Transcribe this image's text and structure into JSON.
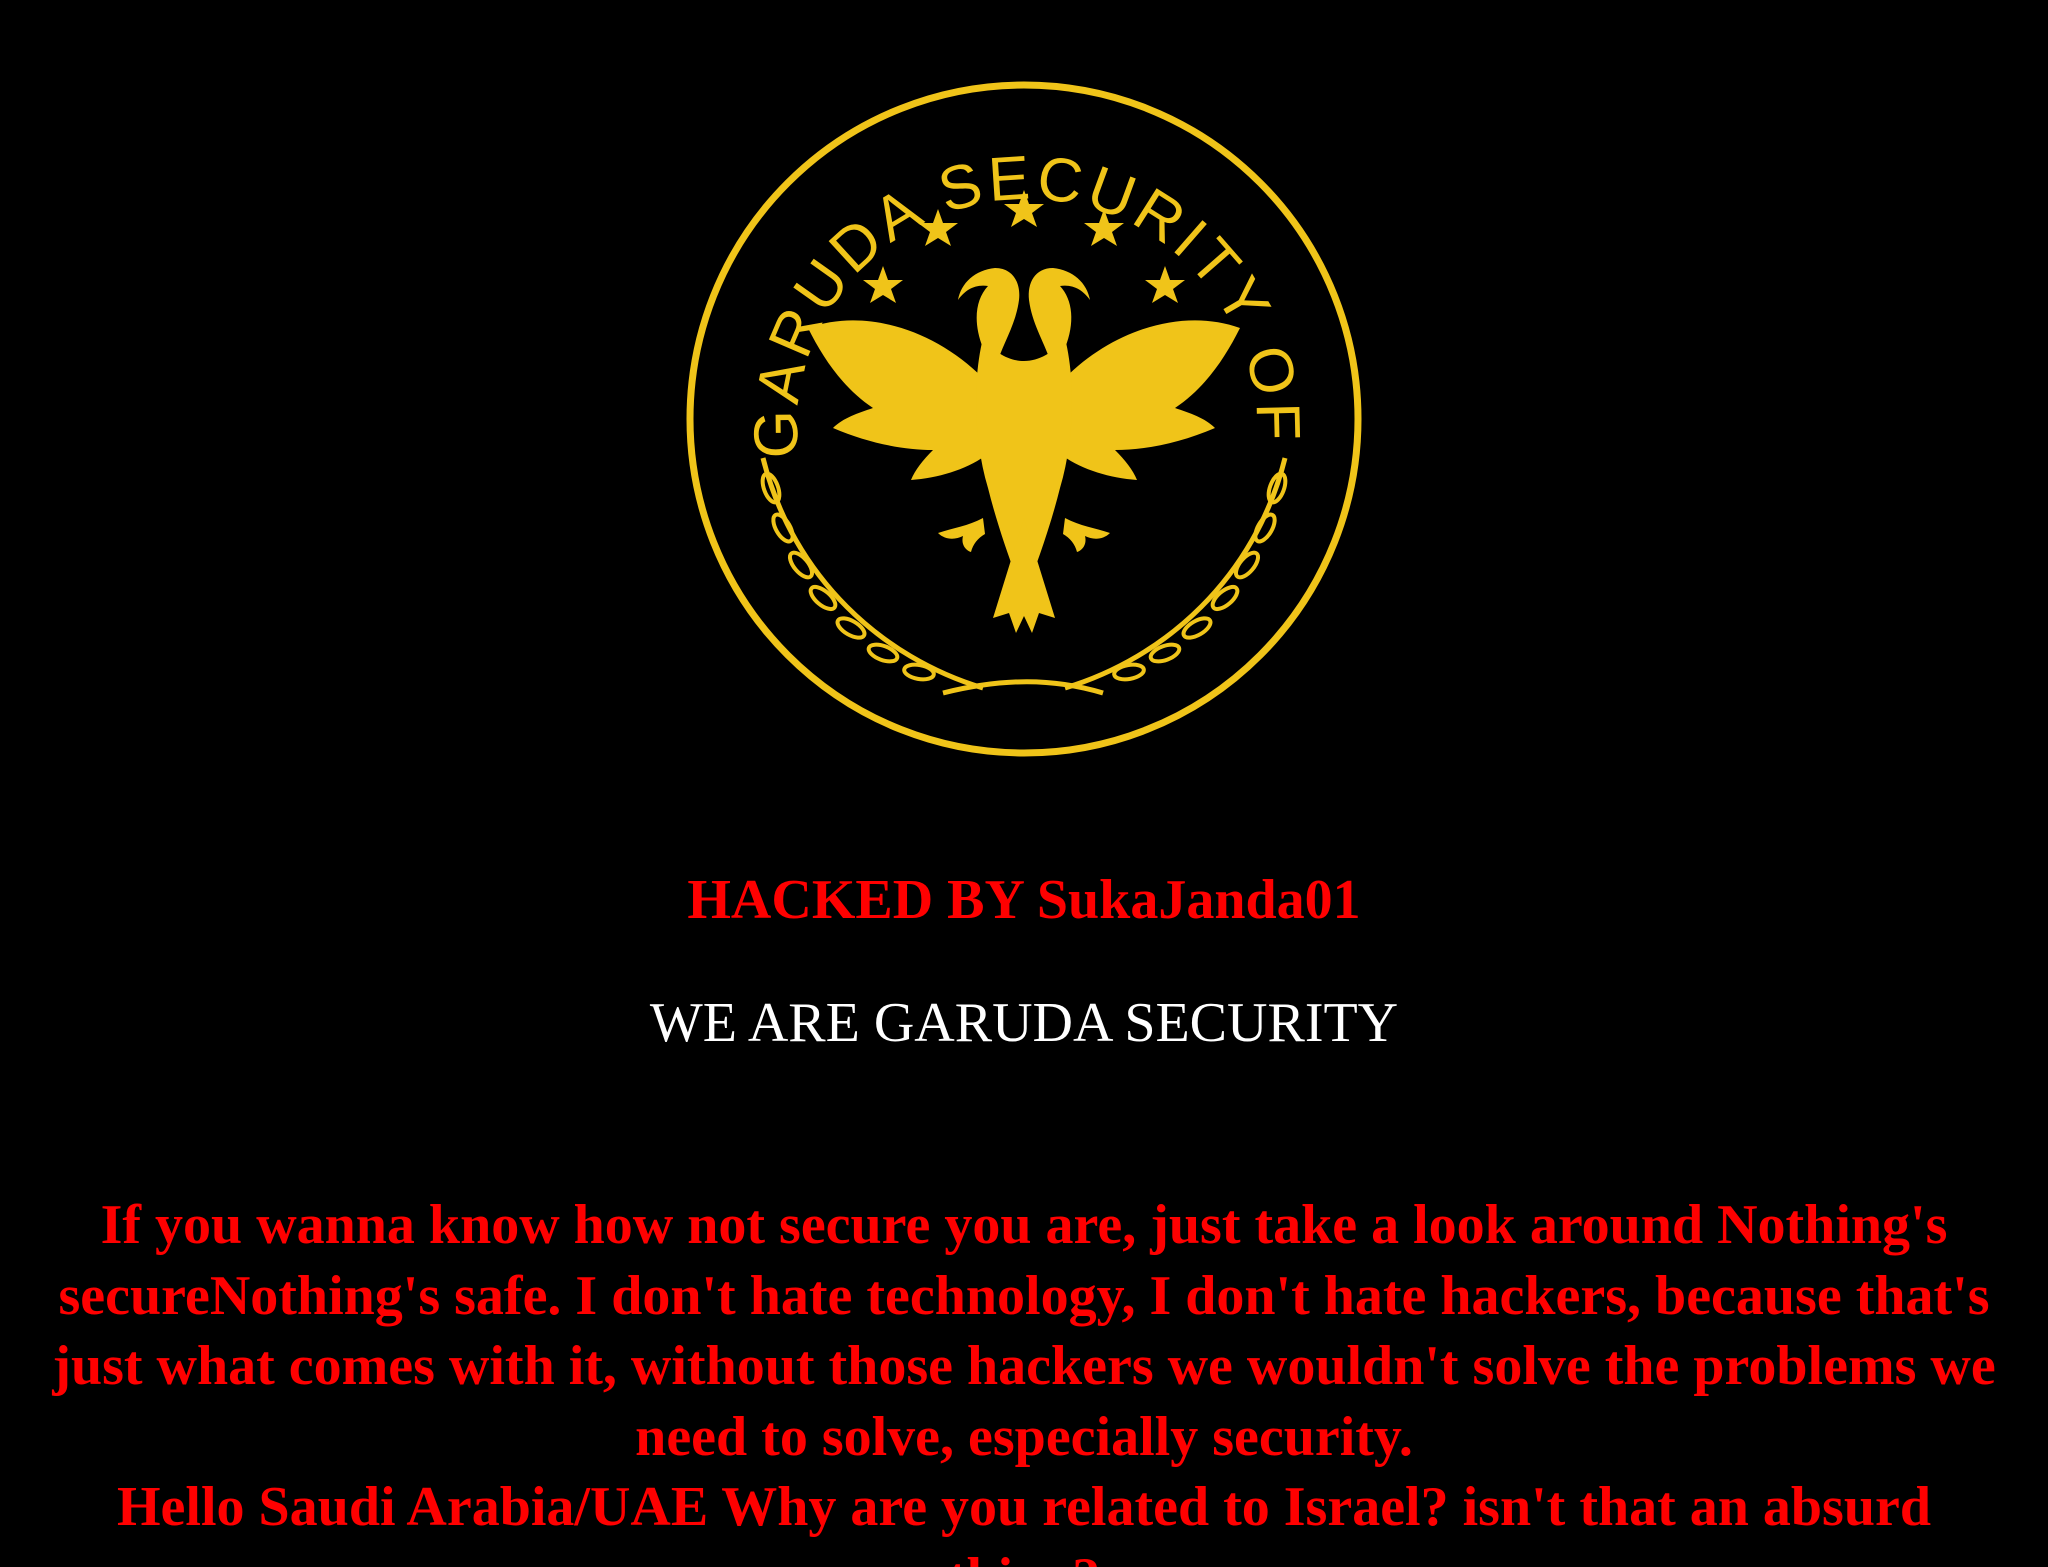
{
  "emblem": {
    "text": "GARUDA SECURITY OFFICIAL",
    "color": "#f0c419",
    "icon": "double-headed-eagle-icon"
  },
  "headline": "HACKED BY SukaJanda01",
  "tagline": "WE ARE GARUDA SECURITY",
  "message": {
    "paragraph": "If you wanna know how not secure you are, just take a look around Nothing's secureNothing's safe. I don't hate technology, I don't hate hackers, because that's just what comes with it, without those hackers we wouldn't solve the problems we need to solve, especially security.",
    "line2": "Hello Saudi Arabia/UAE Why are you related to Israel? isn't that an absurd thing?"
  },
  "colors": {
    "background": "#000000",
    "accent_red": "#ff0000",
    "gold": "#f0c419",
    "white": "#ffffff"
  }
}
